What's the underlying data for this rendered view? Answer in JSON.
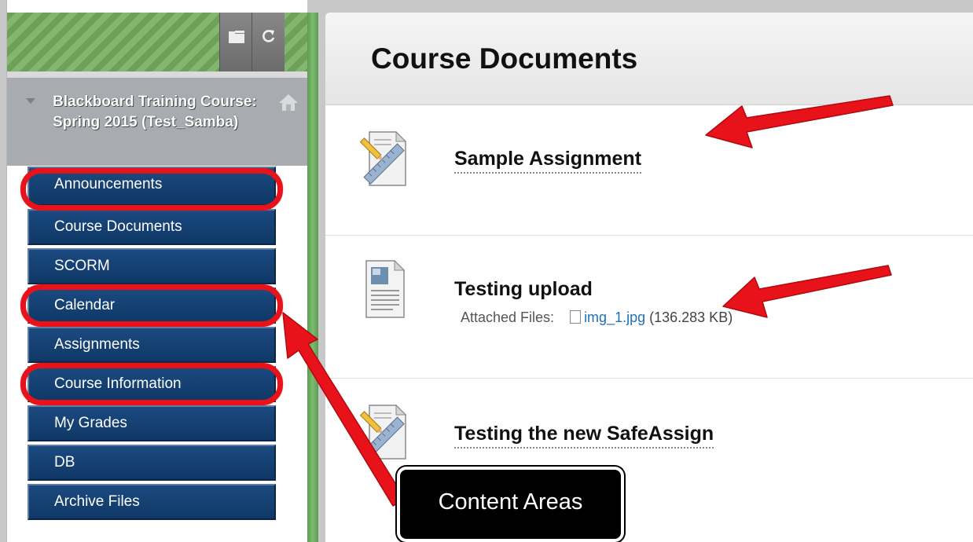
{
  "sidebar": {
    "toolbar": {
      "folder_icon": "folder-view-icon",
      "refresh_icon": "refresh-icon"
    },
    "course_title": "Blackboard Training Course: Spring 2015 (Test_Samba)",
    "home_icon": "home-icon",
    "items": [
      {
        "label": "Announcements",
        "highlighted": true
      },
      {
        "label": "Course Documents",
        "highlighted": false
      },
      {
        "label": "SCORM",
        "highlighted": false
      },
      {
        "label": "Calendar",
        "highlighted": true
      },
      {
        "label": "Assignments",
        "highlighted": false
      },
      {
        "label": "Course Information",
        "highlighted": true
      },
      {
        "label": "My Grades",
        "highlighted": false
      },
      {
        "label": "DB",
        "highlighted": false
      },
      {
        "label": "Archive Files",
        "highlighted": false
      }
    ]
  },
  "main": {
    "page_title": "Course Documents",
    "content_items": [
      {
        "title": "Sample Assignment",
        "icon": "assignment-icon"
      },
      {
        "title": "Testing upload",
        "icon": "document-icon",
        "attached_files_label": "Attached Files:",
        "file_name": "img_1.jpg",
        "file_size": "(136.283 KB)"
      },
      {
        "title": "Testing the new SafeAssign",
        "icon": "assignment-icon"
      }
    ]
  },
  "annotation": {
    "callout_text": "Content Areas",
    "highlight_color": "#e8121a"
  },
  "colors": {
    "nav_button": "#14427a",
    "accent_green": "#6ea05a",
    "link": "#2170b8"
  }
}
